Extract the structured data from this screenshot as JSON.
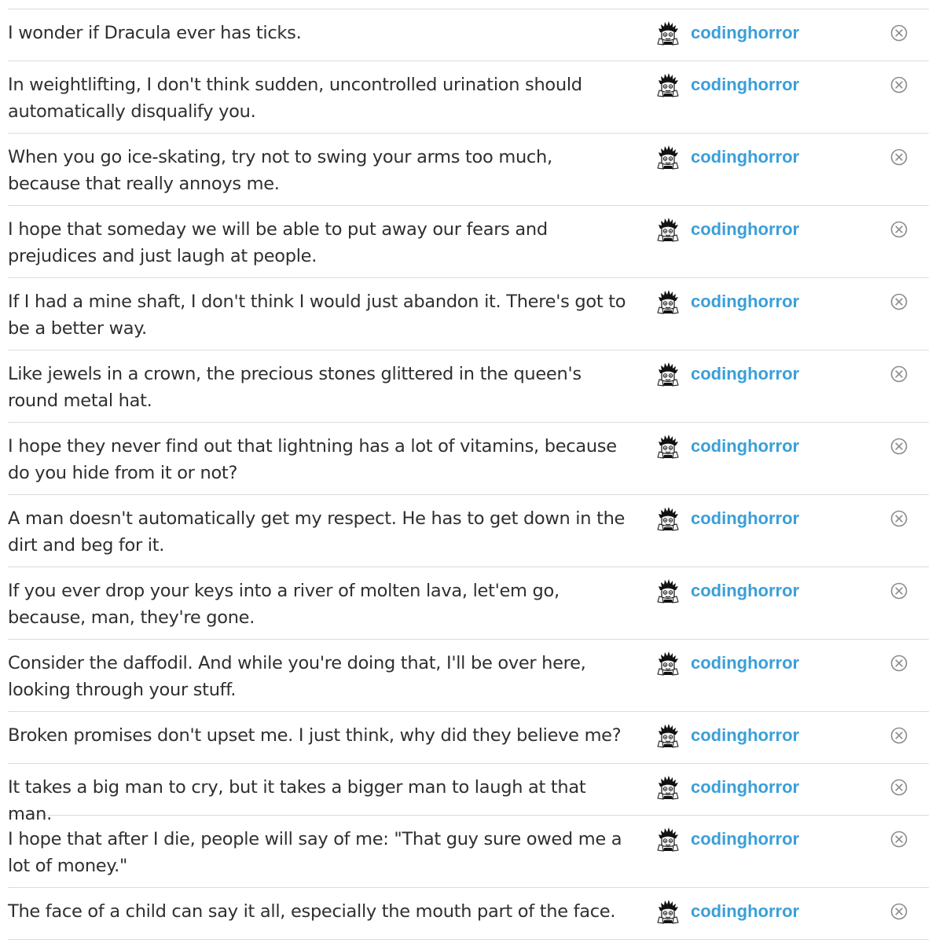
{
  "rows": [
    {
      "text": "I wonder if Dracula ever has ticks.",
      "user": "codinghorror"
    },
    {
      "text": "In weightlifting, I don't think sudden, uncontrolled urination should automatically disqualify you.",
      "user": "codinghorror"
    },
    {
      "text": "When you go ice-skating, try not to swing your arms too much, because that really annoys me.",
      "user": "codinghorror"
    },
    {
      "text": "I hope that someday we will be able to put away our fears and prejudices and just laugh at people.",
      "user": "codinghorror"
    },
    {
      "text": "If I had a mine shaft, I don't think I would just abandon it. There's got to be a better way.",
      "user": "codinghorror"
    },
    {
      "text": "Like jewels in a crown, the precious stones glittered in the queen's round metal hat.",
      "user": "codinghorror"
    },
    {
      "text": "I hope they never find out that lightning has a lot of vitamins, because do you hide from it or not?",
      "user": "codinghorror"
    },
    {
      "text": "A man doesn't automatically get my respect. He has to get down in the dirt and beg for it.",
      "user": "codinghorror"
    },
    {
      "text": "If you ever drop your keys into a river of molten lava, let'em go, because, man, they're gone.",
      "user": "codinghorror"
    },
    {
      "text": "Consider the daffodil. And while you're doing that, I'll be over here, looking through your stuff.",
      "user": "codinghorror"
    },
    {
      "text": "Broken promises don't upset me. I just think, why did they believe me?",
      "user": "codinghorror"
    },
    {
      "text": "It takes a big man to cry, but it takes a bigger man to laugh at that man.",
      "user": "codinghorror"
    },
    {
      "text": "I hope that after I die, people will say of me: \"That guy sure owed me a lot of money.\"",
      "user": "codinghorror"
    },
    {
      "text": "The face of a child can say it all, especially the mouth part of the face.",
      "user": "codinghorror"
    }
  ],
  "icons": {
    "avatar": "spiky-hair-avatar-icon",
    "remove": "circle-x-icon"
  },
  "colors": {
    "username": "#3a9fd9",
    "text": "#2f2f2f",
    "divider": "#dcdcdc",
    "icon": "#8a8a8a"
  }
}
